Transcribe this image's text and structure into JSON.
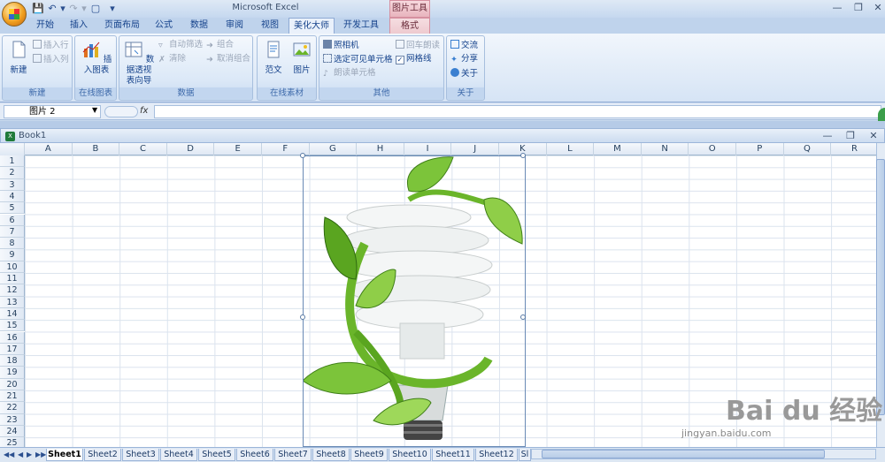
{
  "app": {
    "title": "Microsoft Excel",
    "context_group": "图片工具"
  },
  "tabs": [
    "开始",
    "插入",
    "页面布局",
    "公式",
    "数据",
    "审阅",
    "视图",
    "美化大师",
    "开发工具",
    "格式"
  ],
  "ribbon": {
    "new": {
      "label": "新建",
      "insert_row": "插入行",
      "insert_col": "插入列",
      "group": "新建"
    },
    "chart": {
      "label": "插入图表",
      "group": "在线图表"
    },
    "data": {
      "pivot": "数据透视表向导",
      "pivot_line1": "数据透视",
      "pivot_line2": "表向导",
      "autofilter": "自动筛选",
      "clear": "清除",
      "group_btn": "组合",
      "ungroup": "取消组合",
      "group": "数据"
    },
    "material": {
      "sample": "范文",
      "picture": "图片",
      "group": "在线素材"
    },
    "other": {
      "camera": "照相机",
      "select_visible": "选定可见单元格",
      "read_cell": "朗读单元格",
      "enter_read": "回车朗读",
      "gridlines": "网格线",
      "group": "其他"
    },
    "about": {
      "exchange": "交流",
      "share": "分享",
      "about": "关于",
      "group": "关于"
    }
  },
  "formula_bar": {
    "name_box": "图片 2",
    "fx": "fx",
    "value": ""
  },
  "workbook": {
    "title": "Book1"
  },
  "columns": [
    "A",
    "B",
    "C",
    "D",
    "E",
    "F",
    "G",
    "H",
    "I",
    "J",
    "K",
    "L",
    "M",
    "N",
    "O",
    "P",
    "Q",
    "R"
  ],
  "rows": [
    "1",
    "2",
    "3",
    "4",
    "5",
    "6",
    "7",
    "8",
    "9",
    "10",
    "11",
    "12",
    "13",
    "14",
    "15",
    "16",
    "17",
    "18",
    "19",
    "20",
    "21",
    "22",
    "23",
    "24",
    "25"
  ],
  "sheets": [
    "Sheet1",
    "Sheet2",
    "Sheet3",
    "Sheet4",
    "Sheet5",
    "Sheet6",
    "Sheet7",
    "Sheet8",
    "Sheet9",
    "Sheet10",
    "Sheet11",
    "Sheet12",
    "Sl"
  ],
  "active_sheet": "Sheet1",
  "watermark": {
    "brand": "Bai du 经验",
    "url": "jingyan.baidu.com"
  },
  "colors": {
    "accent": "#15428b",
    "leaf_green": "#6ab52a",
    "ribbon_bg": "#dbe8f7"
  }
}
